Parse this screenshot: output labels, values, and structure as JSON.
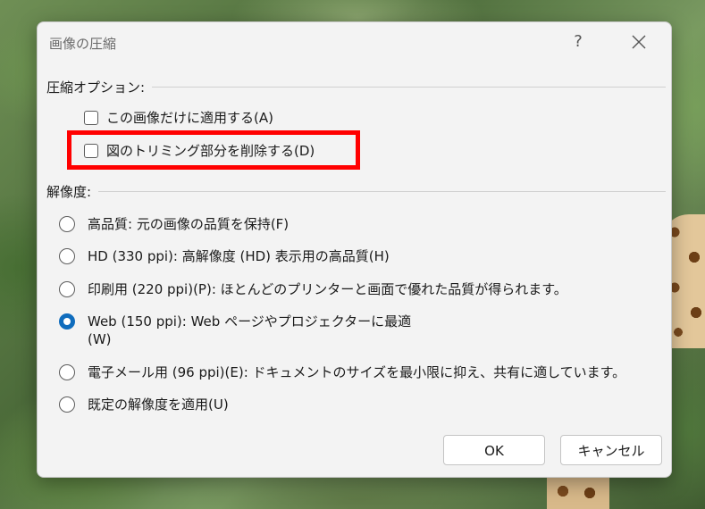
{
  "dialog": {
    "title": "画像の圧縮",
    "help_label": "?",
    "close_icon": "close-icon"
  },
  "compression_options": {
    "header": "圧縮オプション:",
    "apply_only_this": {
      "label": "この画像だけに適用する(A)",
      "checked": false
    },
    "delete_cropped": {
      "label": "図のトリミング部分を削除する(D)",
      "checked": false
    }
  },
  "resolution": {
    "header": "解像度:",
    "options": [
      {
        "label": "高品質: 元の画像の品質を保持(F)",
        "selected": false
      },
      {
        "label": "HD (330 ppi): 高解像度 (HD) 表示用の高品質(H)",
        "selected": false
      },
      {
        "label": "印刷用 (220 ppi)(P): ほとんどのプリンターと画面で優れた品質が得られます。",
        "selected": false
      },
      {
        "label": "Web (150 ppi): Web ページやプロジェクターに最適(W)",
        "selected": true
      },
      {
        "label": "電子メール用 (96 ppi)(E): ドキュメントのサイズを最小限に抑え、共有に適しています。",
        "selected": false
      },
      {
        "label": "既定の解像度を適用(U)",
        "selected": false
      }
    ]
  },
  "buttons": {
    "ok": "OK",
    "cancel": "キャンセル"
  },
  "colors": {
    "accent": "#0f6cbd",
    "highlight": "#ff0000"
  }
}
